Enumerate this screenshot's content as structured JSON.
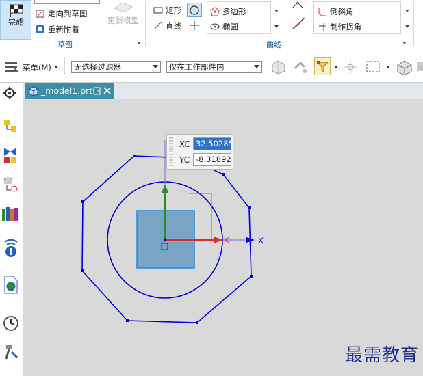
{
  "ribbon": {
    "finish_label": "完成",
    "orient_label": "定向到草图",
    "reattach_label": "重新附着",
    "update_model_label": "更新模型",
    "sketch_group": "草图",
    "rect_label": "矩形",
    "line_label": "直线",
    "polygon_label": "多边形",
    "ellipse_label": "椭圆",
    "curve_group": "曲线",
    "chamfer_label": "倒斜角",
    "corner_label": "制作拐角"
  },
  "toolbar": {
    "menu_label": "菜单(M)",
    "filter_value": "无选择过滤器",
    "scope_value": "仅在工作部件内"
  },
  "tab": {
    "title": "_model1.prt"
  },
  "coord": {
    "xc_label": "XC",
    "xc_value": "32.50285",
    "yc_label": "YC",
    "yc_value": "-8.31892"
  },
  "axis": {
    "x_label": "X"
  },
  "watermark": "最需教育",
  "colors": {
    "sketch_curve": "#0000e0",
    "selection": "#2f73c9",
    "tab": "#3e8ea6",
    "viewport": "#d9d9d9"
  }
}
